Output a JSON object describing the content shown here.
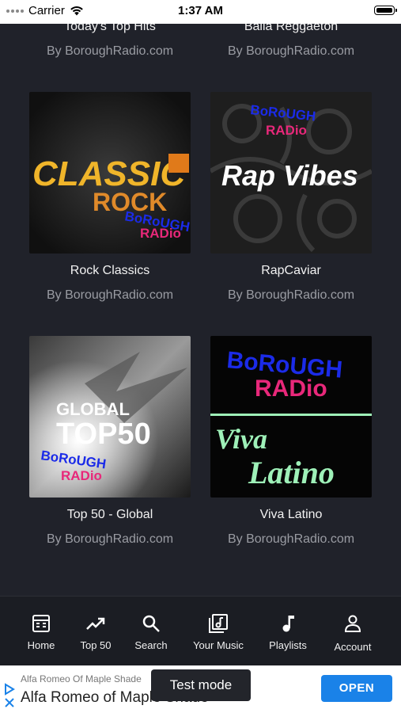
{
  "status_bar": {
    "carrier": "Carrier",
    "time": "1:37 AM"
  },
  "playlists": [
    {
      "title": "Today's Top Hits",
      "subtitle": "By BoroughRadio.com"
    },
    {
      "title": "Baila Reggaeton",
      "subtitle": "By BoroughRadio.com"
    },
    {
      "title": "Rock Classics",
      "subtitle": "By BoroughRadio.com",
      "art": {
        "line1": "CLASSIC",
        "line2": "ROCK",
        "brand1": "BoRoUGH",
        "brand2": "RADio"
      }
    },
    {
      "title": "RapCaviar",
      "subtitle": "By BoroughRadio.com",
      "art": {
        "text": "Rap Vibes",
        "brand1": "BoRoUGH",
        "brand2": "RADio"
      }
    },
    {
      "title": "Top 50 - Global",
      "subtitle": "By BoroughRadio.com",
      "art": {
        "line1": "GLOBAL",
        "line2": "TOP50",
        "brand1": "BoRoUGH",
        "brand2": "RADio"
      }
    },
    {
      "title": "Viva Latino",
      "subtitle": "By BoroughRadio.com",
      "art": {
        "line1": "Viva",
        "line2": "Latino",
        "brand1": "BoRoUGH",
        "brand2": "RADio"
      }
    }
  ],
  "tabs": [
    {
      "label": "Home",
      "icon": "home-icon"
    },
    {
      "label": "Top 50",
      "icon": "trending-icon"
    },
    {
      "label": "Search",
      "icon": "search-icon"
    },
    {
      "label": "Your Music",
      "icon": "library-icon"
    },
    {
      "label": "Playlists",
      "icon": "music-note-icon"
    },
    {
      "label": "Account",
      "icon": "person-icon"
    }
  ],
  "ad": {
    "headline_small": "Alfa Romeo Of Maple Shade",
    "headline": "Alfa Romeo of Maple Shade",
    "cta": "OPEN",
    "test_badge": "Test mode"
  },
  "colors": {
    "background": "#20222a",
    "tabbar": "#1b1d23",
    "accent_blue": "#1a82e8",
    "brand_blue": "#1b2be8",
    "brand_pink": "#e8287a"
  }
}
